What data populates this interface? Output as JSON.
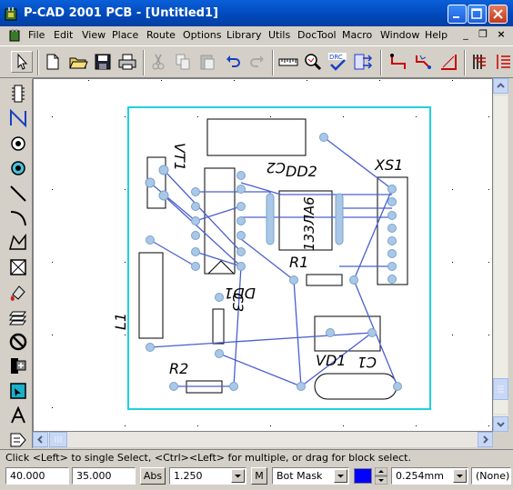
{
  "window": {
    "title": "P-CAD 2001 PCB - [Untitled1]",
    "minimize_label": "_",
    "maximize_label": "□",
    "close_label": "✕"
  },
  "menu": {
    "items": [
      "File",
      "Edit",
      "View",
      "Place",
      "Route",
      "Options",
      "Library",
      "Utils",
      "DocTool",
      "Macro",
      "Window",
      "Help"
    ],
    "mdi_min": "_",
    "mdi_restore": "❐",
    "mdi_close": "×"
  },
  "toolbar": {
    "drc_label": "DRC"
  },
  "pcb": {
    "labels": {
      "vt1": "VT1",
      "dd2": "DD2",
      "c2": "C2",
      "ic_text": "133ЛА6",
      "xs1": "XS1",
      "r1": "R1",
      "dd1": "DD1",
      "c3": "C3",
      "l1": "L1",
      "vd1": "VD1",
      "r2": "R2",
      "c1": "C1"
    }
  },
  "status": {
    "message": "Click <Left> to single Select, <Ctrl><Left> for multiple, or drag for block select."
  },
  "bottom": {
    "x_coord": "40.000",
    "y_coord": "35.000",
    "abs_label": "Abs",
    "grid_value": "1.250",
    "m_label": "M",
    "layer": "Bot Mask",
    "layer_color": "#0000ff",
    "width_value": "0.254mm",
    "none_value": "(None)"
  }
}
